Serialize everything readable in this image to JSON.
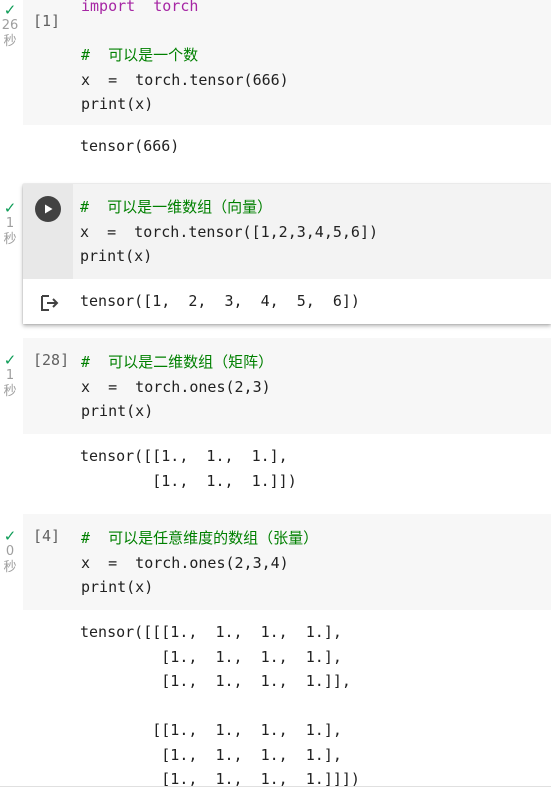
{
  "cells": [
    {
      "exec_count": "[1]",
      "check": "✓",
      "time": [
        "26",
        "秒"
      ],
      "code": [
        "import  torch",
        "",
        "#  可以是一个数",
        "x  =  torch.tensor(666)",
        "print(x)"
      ],
      "output": [
        "tensor(666)"
      ]
    },
    {
      "exec_count": "",
      "check": "✓",
      "time": [
        "1",
        "秒"
      ],
      "code": [
        "#  可以是一维数组（向量）",
        "x  =  torch.tensor([1,2,3,4,5,6])",
        "print(x)"
      ],
      "output": [
        "tensor([1,  2,  3,  4,  5,  6])"
      ]
    },
    {
      "exec_count": "[28]",
      "check": "✓",
      "time": [
        "1",
        "秒"
      ],
      "code": [
        "#  可以是二维数组（矩阵）",
        "x  =  torch.ones(2,3)",
        "print(x)"
      ],
      "output": [
        "tensor([[1.,  1.,  1.],",
        "        [1.,  1.,  1.]])"
      ]
    },
    {
      "exec_count": "[4]",
      "check": "✓",
      "time": [
        "0",
        "秒"
      ],
      "code": [
        "#  可以是任意维度的数组（张量）",
        "x  =  torch.ones(2,3,4)",
        "print(x)"
      ],
      "output": [
        "tensor([[[1.,  1.,  1.,  1.],",
        "         [1.,  1.,  1.,  1.],",
        "         [1.,  1.,  1.,  1.]],",
        "",
        "        [[1.,  1.,  1.,  1.],",
        "         [1.,  1.,  1.,  1.],",
        "         [1.,  1.,  1.,  1.]]])"
      ]
    }
  ],
  "icons": {
    "run": "play-icon",
    "output": "output-redirect-icon",
    "check": "checkmark-icon"
  },
  "colors": {
    "check": "#0f9d58",
    "keyword": "#a626a4",
    "comment": "#008000",
    "number": "#09885a",
    "cell_bg": "#f7f7f7"
  }
}
